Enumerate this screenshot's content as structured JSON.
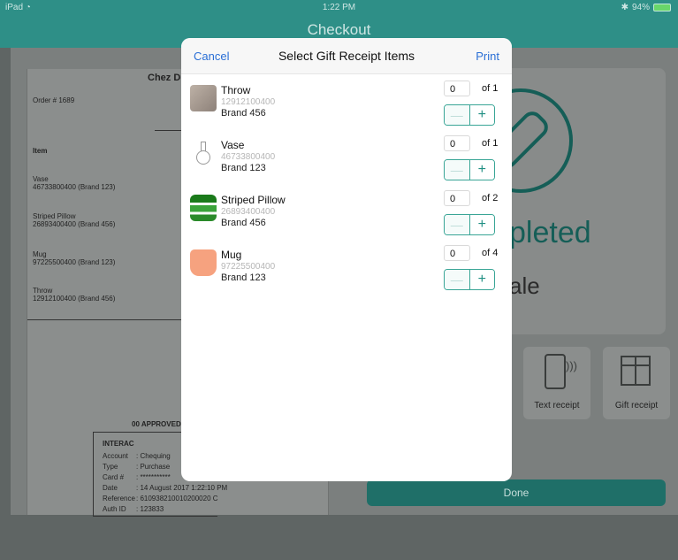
{
  "status": {
    "left": "iPad ",
    "time": "1:22 PM",
    "battery": "94%"
  },
  "nav": {
    "title": "Checkout"
  },
  "receipt": {
    "shop": "Chez D",
    "order": "Order # 1689",
    "item_header": "Item",
    "items": [
      {
        "name": "Vase",
        "line": "46733800400 (Brand 123)"
      },
      {
        "name": "Striped Pillow",
        "line": "26893400400 (Brand 456)"
      },
      {
        "name": "Mug",
        "line": "97225500400 (Brand 123)"
      },
      {
        "name": "Throw",
        "line": "12912100400 (Brand 456)"
      }
    ],
    "approved": "00 APPROVED - T",
    "interac": {
      "title": "INTERAC",
      "account_label": "Account",
      "account_value": ": Chequing",
      "type_label": "Type",
      "type_value": ": Purchase",
      "card_label": "Card #",
      "card_value": ": ***********",
      "date_label": "Date",
      "date_value": ": 14 August 2017 1:22:10 PM",
      "ref_label": "Reference",
      "ref_value": ": 610938210010200020 C",
      "auth_label": "Auth ID",
      "auth_value": ": 123833"
    }
  },
  "right": {
    "completed": "pleted",
    "sale": "ale",
    "text_receipt": "Text receipt",
    "gift_receipt": "Gift receipt",
    "done": "Done"
  },
  "modal": {
    "cancel": "Cancel",
    "title": "Select Gift Receipt Items",
    "print": "Print",
    "items": [
      {
        "name": "Throw",
        "sku": "12912100400",
        "brand": "Brand 456",
        "qty": "0",
        "of": "of 1"
      },
      {
        "name": "Vase",
        "sku": "46733800400",
        "brand": "Brand 123",
        "qty": "0",
        "of": "of 1"
      },
      {
        "name": "Striped Pillow",
        "sku": "26893400400",
        "brand": "Brand 456",
        "qty": "0",
        "of": "of 2"
      },
      {
        "name": "Mug",
        "sku": "97225500400",
        "brand": "Brand 123",
        "qty": "0",
        "of": "of 4"
      }
    ]
  }
}
